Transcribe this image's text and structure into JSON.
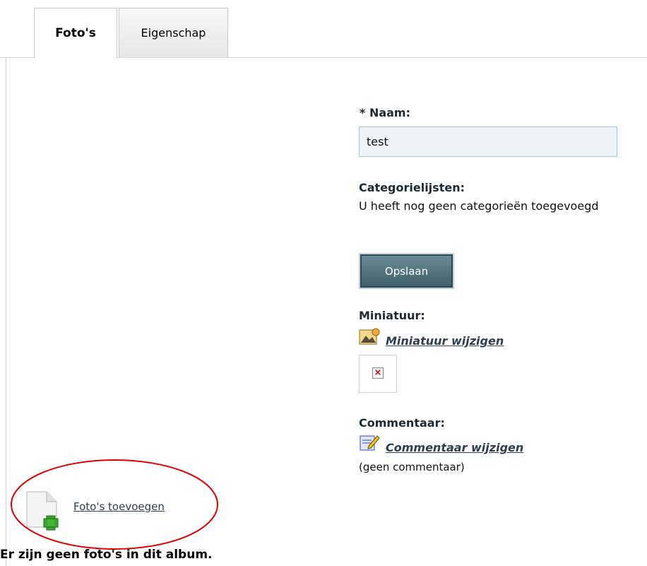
{
  "tabs": [
    {
      "label": "Foto's",
      "active": true
    },
    {
      "label": "Eigenschap",
      "active": false
    }
  ],
  "form": {
    "name_label": "* Naam:",
    "name_value": "test",
    "categories_label": "Categorielijsten:",
    "categories_text": "U heeft nog geen categorieën toegevoegd",
    "save_label": "Opslaan",
    "thumbnail_label": "Miniatuur:",
    "thumbnail_link": "Miniatuur wijzigen",
    "comment_label": "Commentaar:",
    "comment_link": "Commentaar wijzigen",
    "comment_value": "(geen commentaar)"
  },
  "photos": {
    "add_link": "Foto's toevoegen",
    "empty_message": "Er zijn geen foto's in dit album."
  },
  "colors": {
    "highlight_ellipse": "#e00000",
    "button": "#4f717c",
    "link": "#2f3f52"
  }
}
